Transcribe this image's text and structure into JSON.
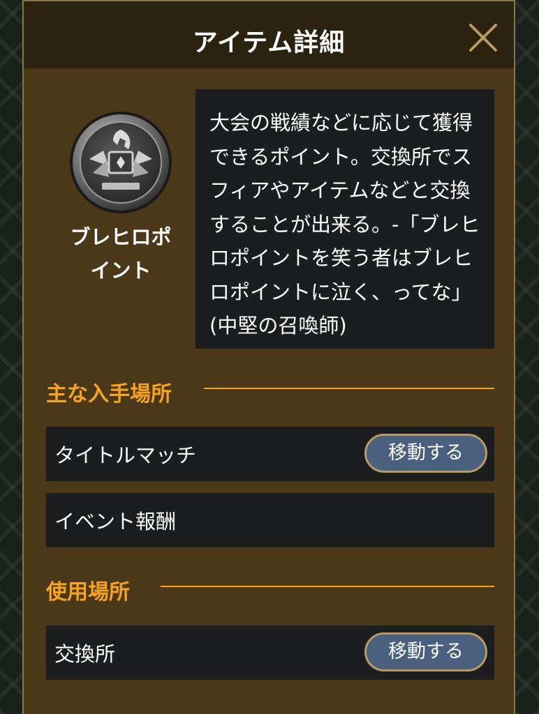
{
  "dialog": {
    "title": "アイテム詳細",
    "close_icon": "close-icon"
  },
  "item": {
    "icon": "brave-hero-point-medal-icon",
    "name_line1": "ブレヒロポ",
    "name_line2": "イント",
    "description": "大会の戦績などに応じて獲得できるポイント。交換所でスフィアやアイテムなどと交換することが出来る。-「ブレヒロポイントを笑う者はブレヒロポイントに泣く、ってな」(中堅の召喚師)"
  },
  "sections": {
    "acquisition": {
      "title": "主な入手場所",
      "rows": [
        {
          "label": "タイトルマッチ",
          "button": "移動する"
        },
        {
          "label": "イベント報酬"
        }
      ]
    },
    "usage": {
      "title": "使用場所",
      "rows": [
        {
          "label": "交換所",
          "button": "移動する"
        }
      ]
    }
  },
  "colors": {
    "accent": "#f7a31c",
    "panel": "#4a3819",
    "button": "#49607e"
  }
}
